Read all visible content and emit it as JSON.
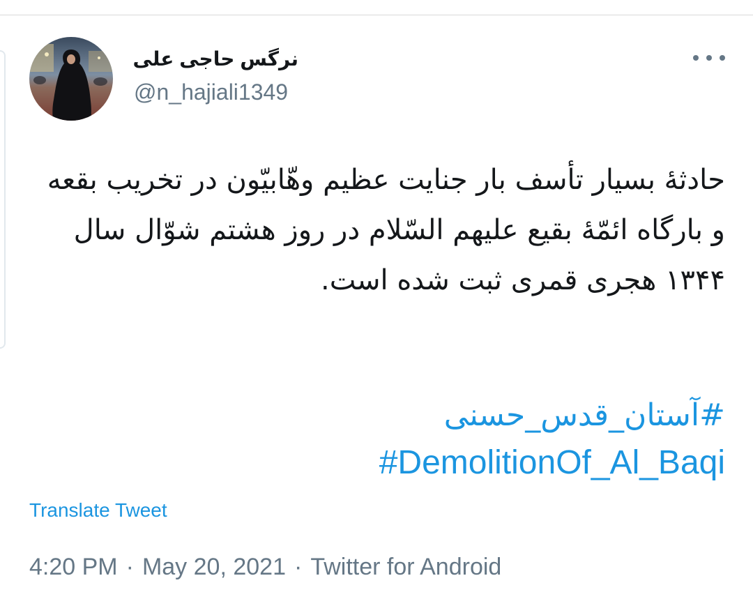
{
  "user": {
    "display_name": "نرگس حاجی علی",
    "handle": "@n_hajiali1349",
    "avatar_icon": "profile-photo"
  },
  "tweet": {
    "text": "حادثۀ بسیار تأسف بار جنایت عظیم وهّابیّون در تخریب بقعه و بارگاه ائمّۀ بقیع علیهم السّلام در روز هشتم شوّال سال ۱۳۴۴ هجری قمری ثبت شده است.",
    "hashtags": [
      "#آستان_قدس_حسنی",
      "#DemolitionOf_Al_Baqi"
    ],
    "translate_label": "Translate Tweet"
  },
  "meta": {
    "time": "4:20 PM",
    "date": "May 20, 2021",
    "source": "Twitter for Android",
    "separator": "·"
  },
  "colors": {
    "link": "#1b95e0",
    "secondary": "#657786",
    "text": "#14171a"
  },
  "icons": {
    "more": "more-options-icon"
  }
}
